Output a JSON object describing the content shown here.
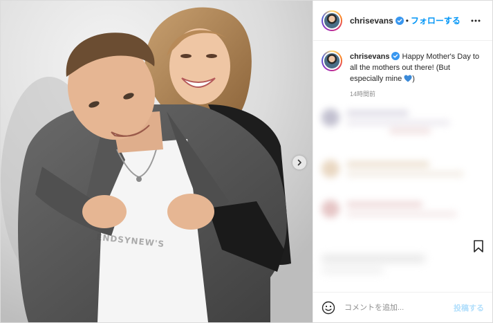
{
  "post": {
    "author": "chrisevans",
    "verified": true,
    "follow_label": "フォローする",
    "separator": "•",
    "caption": "Happy Mother's Day to all the mothers out there! (But especially mine ",
    "caption_end": ")",
    "caption_emoji": "blue-heart-icon",
    "timestamp": "14時間前",
    "photo_watermark": "ENDSYNEW'S"
  },
  "comment_box": {
    "placeholder": "コメントを追加...",
    "post_label": "投稿する"
  },
  "colors": {
    "link": "#0095f6",
    "post_disabled": "#b2dffc",
    "muted": "#8e8e8e",
    "heart": "#3b8ad8"
  },
  "icons": [
    "verified-badge-icon",
    "more-options-icon",
    "carousel-next-icon",
    "bookmark-icon",
    "emoji-icon",
    "blue-heart-icon"
  ]
}
